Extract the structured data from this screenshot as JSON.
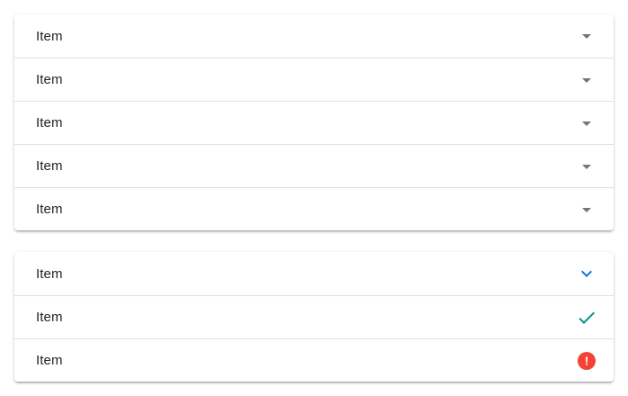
{
  "group_one": {
    "panels": [
      {
        "label": "Item",
        "icon": "caret-down-icon"
      },
      {
        "label": "Item",
        "icon": "caret-down-icon"
      },
      {
        "label": "Item",
        "icon": "caret-down-icon"
      },
      {
        "label": "Item",
        "icon": "caret-down-icon"
      },
      {
        "label": "Item",
        "icon": "caret-down-icon"
      }
    ]
  },
  "group_two": {
    "panels": [
      {
        "label": "Item",
        "icon": "chevron-down-icon",
        "icon_color": "#1976d2"
      },
      {
        "label": "Item",
        "icon": "check-icon",
        "icon_color": "#009688"
      },
      {
        "label": "Item",
        "icon": "error-icon",
        "icon_color": "#f44336",
        "icon_glyph": "!"
      }
    ]
  },
  "colors": {
    "caret": "#757575",
    "divider": "#e0e0e0",
    "text": "#212121"
  }
}
